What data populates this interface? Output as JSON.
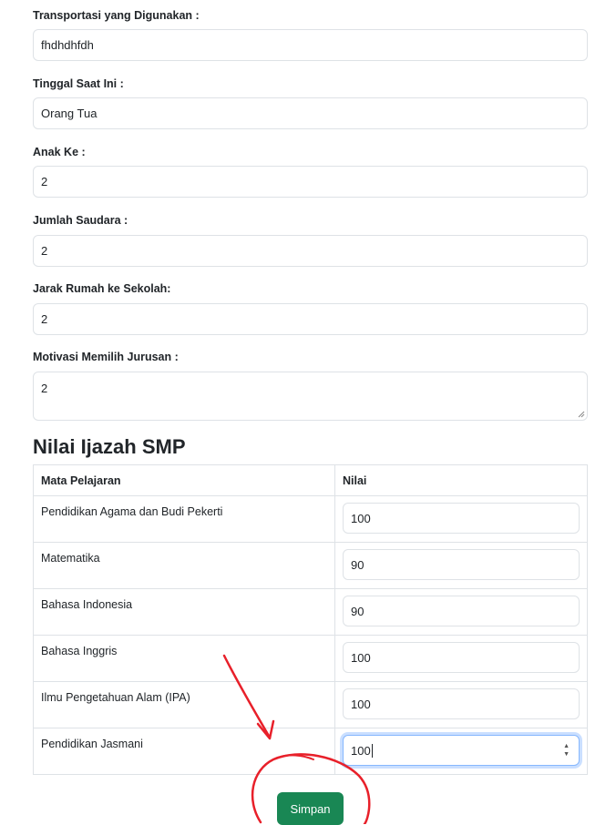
{
  "form": {
    "fields": [
      {
        "label": "Transportasi yang Digunakan :",
        "value": "fhdhdhfdh"
      },
      {
        "label": "Tinggal Saat Ini :",
        "value": "Orang Tua"
      },
      {
        "label": "Anak Ke :",
        "value": "2"
      },
      {
        "label": "Jumlah Saudara :",
        "value": "2"
      },
      {
        "label": "Jarak Rumah ke Sekolah:",
        "value": "2"
      }
    ],
    "motivation": {
      "label": "Motivasi Memilih Jurusan :",
      "value": "2"
    }
  },
  "grades": {
    "title": "Nilai Ijazah SMP",
    "headers": {
      "subject": "Mata Pelajaran",
      "score": "Nilai"
    },
    "rows": [
      {
        "subject": "Pendidikan Agama dan Budi Pekerti",
        "score": "100"
      },
      {
        "subject": "Matematika",
        "score": "90"
      },
      {
        "subject": "Bahasa Indonesia",
        "score": "90"
      },
      {
        "subject": "Bahasa Inggris",
        "score": "100"
      },
      {
        "subject": "Ilmu Pengetahuan Alam (IPA)",
        "score": "100"
      },
      {
        "subject": "Pendidikan Jasmani",
        "score": "100"
      }
    ]
  },
  "actions": {
    "save_label": "Simpan"
  },
  "colors": {
    "primary_button": "#198754",
    "focus_ring": "#86b7fe",
    "annotation": "#e8202a"
  }
}
